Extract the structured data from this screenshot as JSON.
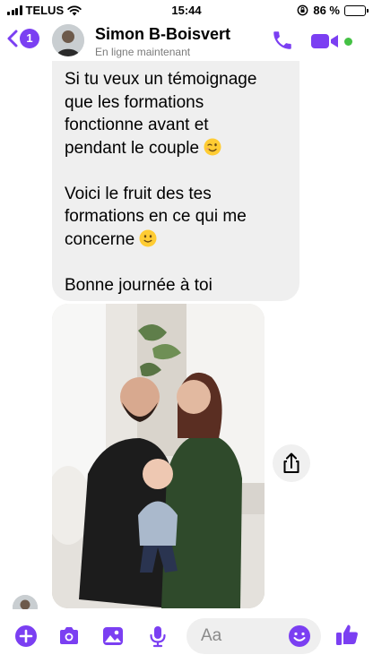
{
  "status_bar": {
    "carrier": "TELUS",
    "time": "15:44",
    "battery": "86 %",
    "battery_level": 0.86
  },
  "header": {
    "contact_name": "Simon B-Boisvert",
    "contact_status": "En ligne maintenant",
    "back_badge": "1",
    "back_icon": "chevron-left-icon",
    "call_icon": "phone-icon",
    "video_icon": "video-camera-icon",
    "accent_color": "#7b3ff2",
    "online_color": "#44c144"
  },
  "message": {
    "line_1": "Si tu veux un témoignage",
    "line_2": "que les formations",
    "line_3": "fonctionne avant et",
    "line_4": "pendant le couple",
    "line_5": "Voici le fruit des tes",
    "line_6": "formations en ce qui me",
    "line_7": "concerne",
    "line_8": "Bonne journée à toi",
    "emoji_1": "winking-face-emoji",
    "emoji_2": "slightly-smiling-face-emoji"
  },
  "composer": {
    "placeholder": "Aa",
    "icons": [
      "plus-icon",
      "camera-icon",
      "image-icon",
      "microphone-icon",
      "emoji-icon",
      "thumbs-up-icon"
    ]
  }
}
